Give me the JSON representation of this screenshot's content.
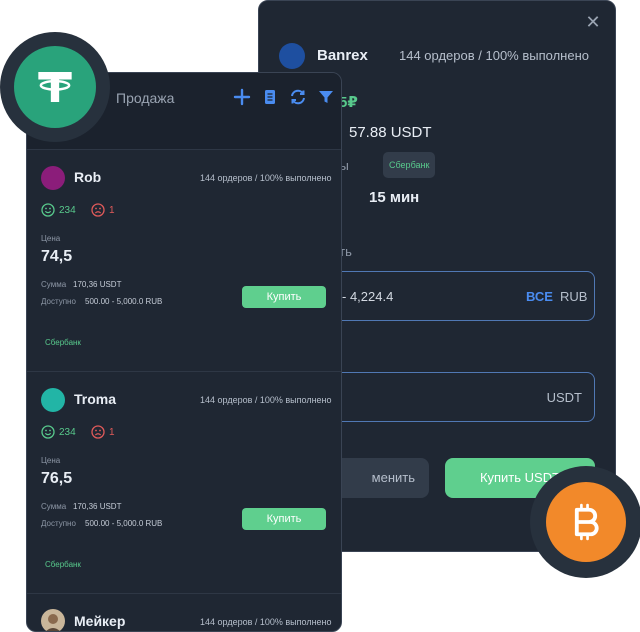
{
  "trade_dialog": {
    "close_label": "✕",
    "seller_name": "Banrex",
    "seller_stats": "144 ордеров / 100% выполнено",
    "price": "5₽",
    "amount": "57.88 USDT",
    "payment_label": "латы",
    "payment_bank": "Сбербанк",
    "time_label": "ты",
    "time_value": "15 мин",
    "pay_title": "атить",
    "pay_range": "- 4,224.4",
    "pay_all": "ВСЕ",
    "pay_currency": "RUB",
    "receive_currency": "USDT",
    "cancel_label": "менить",
    "buy_label": "Купить USDT"
  },
  "offers_panel": {
    "title": "Продажа",
    "tools": [
      "plus-icon",
      "clipboard-icon",
      "refresh-icon",
      "filter-icon"
    ],
    "offers": [
      {
        "name": "Rob",
        "avatar_color": "#8b1d7a",
        "stats": "144 ордеров / 100% выполнено",
        "likes": "234",
        "dislikes": "1",
        "price_label": "Цена",
        "price": "74,5",
        "sum_label": "Сумма",
        "sum_value": "170,36  USDT",
        "avail_label": "Доступно",
        "avail_value": "500.00 - 5,000.0  RUB",
        "buy_label": "Купить",
        "bank": "Сбербанк"
      },
      {
        "name": "Troma",
        "avatar_color": "#22b5a6",
        "stats": "144 ордеров / 100% выполнено",
        "likes": "234",
        "dislikes": "1",
        "price_label": "Цена",
        "price": "76,5",
        "sum_label": "Сумма",
        "sum_value": "170,36  USDT",
        "avail_label": "Доступно",
        "avail_value": "500.00 - 5,000.0  RUB",
        "buy_label": "Купить",
        "bank": "Сбербанк"
      },
      {
        "name": "Мейкер",
        "stats": "144 ордеров / 100% выполнено"
      }
    ]
  },
  "colors": {
    "accent_green": "#5fcf8e",
    "accent_blue": "#4a8cf0",
    "panel_bg": "#1f2733",
    "usdt_green": "#29a37b",
    "btc_orange": "#f2892a"
  }
}
